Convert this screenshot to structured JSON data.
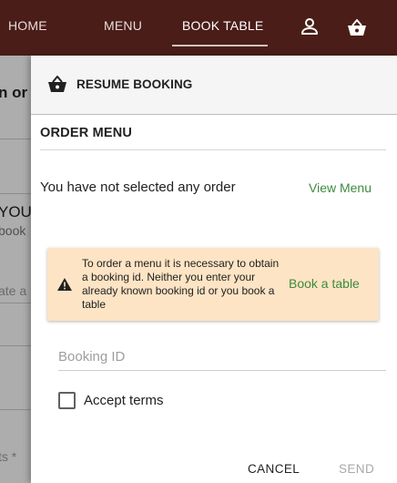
{
  "nav": {
    "home": "HOME",
    "menu": "MENU",
    "book_table": "BOOK TABLE",
    "user_icon": "account-icon",
    "basket_icon": "shopping-basket-icon"
  },
  "background": {
    "title_fragment": "n or b",
    "heading_fragment": "YOUR",
    "sub_fragment": "book",
    "field_placeholder_fragment": "ate a",
    "field_required_fragment": "ts *"
  },
  "sheet": {
    "resume_label": "RESUME BOOKING",
    "resume_icon": "shopping-basket-icon",
    "order_title": "ORDER MENU",
    "empty_text": "You have not selected any order",
    "view_menu": "View Menu",
    "warning": {
      "icon": "warning-icon",
      "text": "To order a menu it is necessary to obtain a booking id. Neither you enter your already known booking id or you book a table",
      "book_link": "Book a table"
    },
    "booking_id_placeholder": "Booking ID",
    "booking_id_value": "",
    "accept_terms": "Accept terms",
    "accept_terms_checked": false,
    "cancel": "CANCEL",
    "send": "SEND"
  },
  "colors": {
    "topbar": "#4a1d18",
    "link_green": "#3f8a3f",
    "warning_bg": "#fde4c4"
  }
}
